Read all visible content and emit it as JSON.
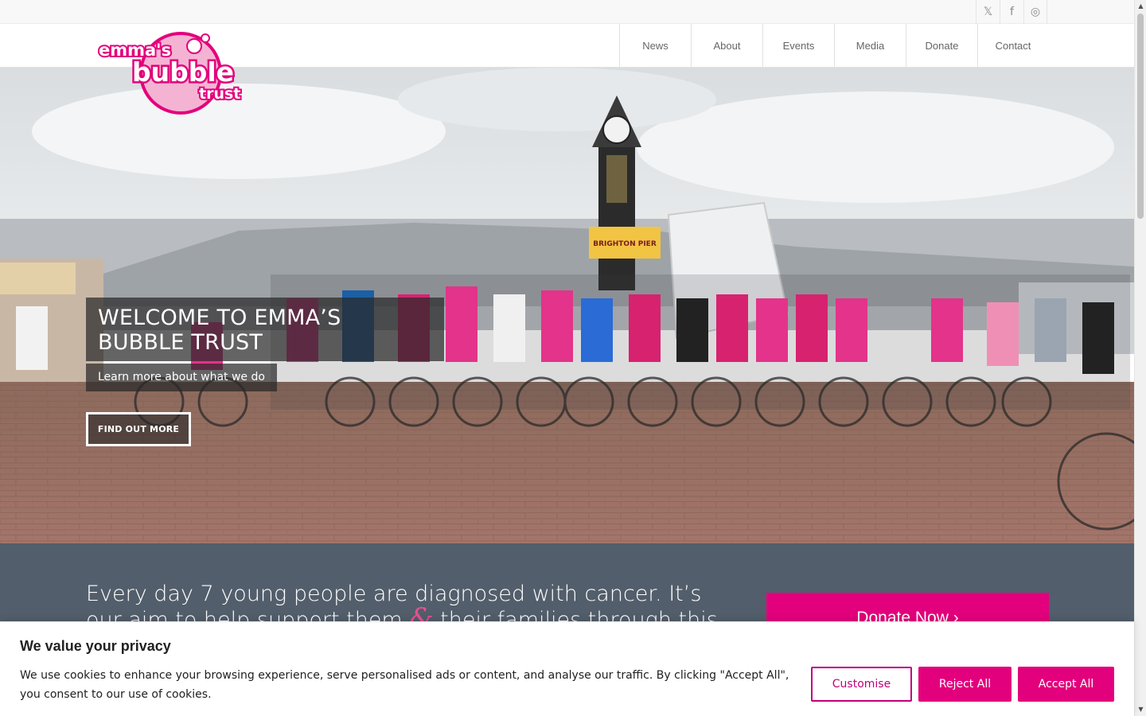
{
  "social": {
    "items": [
      {
        "icon": "x-icon",
        "glyph": "𝕏"
      },
      {
        "icon": "facebook-icon",
        "glyph": "f"
      },
      {
        "icon": "instagram-icon",
        "glyph": "◎"
      }
    ]
  },
  "logo": {
    "line1": "emma's",
    "line2": "bubble",
    "line3": "trust"
  },
  "nav": {
    "items": [
      {
        "label": "News"
      },
      {
        "label": "About"
      },
      {
        "label": "Events"
      },
      {
        "label": "Media"
      },
      {
        "label": "Donate"
      },
      {
        "label": "Contact"
      }
    ]
  },
  "hero": {
    "title": "WELCOME TO EMMA’S BUBBLE TRUST",
    "subtitle": "Learn more about what we do",
    "button": "FIND OUT MORE",
    "sign_text": "BRIGHTON PIER"
  },
  "mission": {
    "line1": "Every day 7 young people are diagnosed with cancer. It’s",
    "line2_before": "our aim to help support them ",
    "amp": "&",
    "line2_after": " their families through this"
  },
  "donate": {
    "label": "Donate Now ›"
  },
  "cookie": {
    "title": "We value your privacy",
    "text": "We use cookies to enhance your browsing experience, serve personalised ads or content, and analyse our traffic. By clicking \"Accept All\", you consent to our use of cookies.",
    "customise": "Customise",
    "reject": "Reject All",
    "accept": "Accept All"
  },
  "colors": {
    "brand_pink": "#e3007c",
    "slate": "#525e6b",
    "outline_pink": "#c0007a"
  }
}
